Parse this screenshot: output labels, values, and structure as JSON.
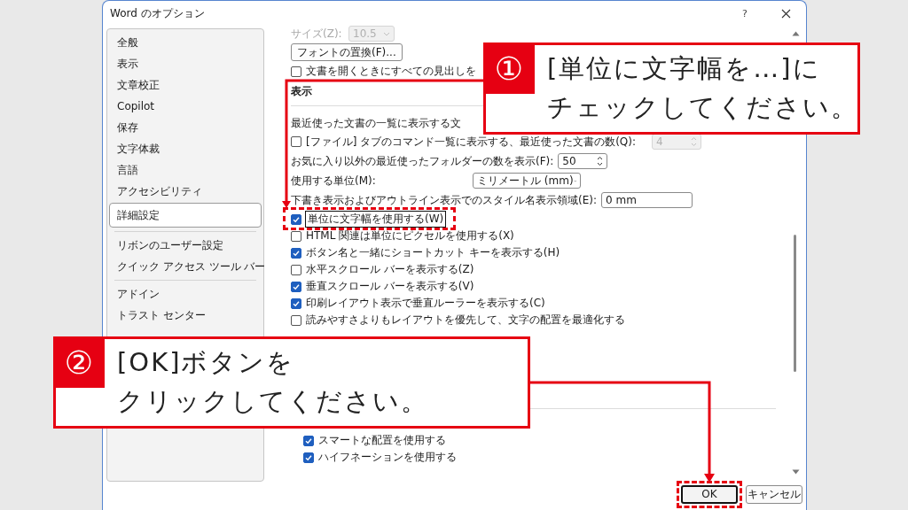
{
  "window": {
    "title": "Word のオプション",
    "help": "?"
  },
  "sidebar": {
    "items": [
      {
        "label": "全般",
        "selected": false
      },
      {
        "label": "表示",
        "selected": false
      },
      {
        "label": "文章校正",
        "selected": false
      },
      {
        "label": "Copilot",
        "selected": false
      },
      {
        "label": "保存",
        "selected": false
      },
      {
        "label": "文字体裁",
        "selected": false
      },
      {
        "label": "言語",
        "selected": false
      },
      {
        "label": "アクセシビリティ",
        "selected": false
      },
      {
        "label": "詳細設定",
        "selected": true
      },
      {
        "label": "リボンのユーザー設定",
        "selected": false
      },
      {
        "label": "クイック アクセス ツール バー",
        "selected": false
      },
      {
        "label": "アドイン",
        "selected": false
      },
      {
        "label": "トラスト センター",
        "selected": false
      }
    ]
  },
  "top": {
    "size_label": "サイズ(Z):",
    "size_value": "10.5",
    "disabled": true,
    "font_button": "フォントの置換(F)...",
    "open_checkbox": {
      "label": "文書を開くときにすべての見出しを",
      "checked": false
    }
  },
  "display": {
    "heading": "表示",
    "rows": [
      {
        "kind": "label",
        "label": "最近使った文書の一覧に表示する文"
      },
      {
        "kind": "checkbox",
        "label": "[ファイル] タブのコマンド一覧に表示する、最近使った文書の数(Q):",
        "checked": false,
        "focused": false,
        "highlighted": false,
        "control": {
          "kind": "spin",
          "value": "4",
          "disabled": true
        }
      },
      {
        "kind": "label",
        "label": "お気に入り以外の最近使ったフォルダーの数を表示(F):",
        "control": {
          "kind": "spin",
          "value": "50",
          "disabled": false
        }
      },
      {
        "kind": "label",
        "label": "使用する単位(M):",
        "control": {
          "kind": "select",
          "value": "ミリメートル (mm)",
          "disabled": false
        }
      },
      {
        "kind": "label",
        "label": "下書き表示およびアウトライン表示でのスタイル名表示領域(E):",
        "control": {
          "kind": "text",
          "value": "0 mm",
          "disabled": false
        }
      },
      {
        "kind": "checkbox",
        "label": "単位に文字幅を使用する(W)",
        "checked": true,
        "focused": true,
        "highlighted": true
      },
      {
        "kind": "checkbox",
        "label": "HTML 関連は単位にピクセルを使用する(X)",
        "checked": false,
        "focused": false,
        "highlighted": false
      },
      {
        "kind": "checkbox",
        "label": "ボタン名と一緒にショートカット キーを表示する(H)",
        "checked": true,
        "focused": false,
        "highlighted": false
      },
      {
        "kind": "checkbox",
        "label": "水平スクロール バーを表示する(Z)",
        "checked": false,
        "focused": false,
        "highlighted": false
      },
      {
        "kind": "checkbox",
        "label": "垂直スクロール バーを表示する(V)",
        "checked": true,
        "focused": false,
        "highlighted": false
      },
      {
        "kind": "checkbox",
        "label": "印刷レイアウト表示で垂直ルーラーを表示する(C)",
        "checked": true,
        "focused": false,
        "highlighted": false
      },
      {
        "kind": "checkbox",
        "label": "読みやすさよりもレイアウトを優先して、文字の配置を最適化する",
        "checked": false,
        "focused": false,
        "highlighted": false
      }
    ]
  },
  "typography": {
    "rows": [
      {
        "kind": "checkbox",
        "label": "スマートな配置を使用する",
        "checked": true,
        "focused": false,
        "highlighted": false
      },
      {
        "kind": "checkbox",
        "label": "ハイフネーションを使用する",
        "checked": true,
        "focused": false,
        "highlighted": false
      }
    ]
  },
  "buttons": [
    {
      "label": "OK",
      "default": true,
      "highlighted": true
    },
    {
      "label": "キャンセル",
      "default": false,
      "highlighted": false
    }
  ],
  "callouts": [
    {
      "number": "①",
      "lines": [
        "[単位に文字幅を…]に",
        "チェックしてください。"
      ]
    },
    {
      "number": "②",
      "lines": [
        "[OK]ボタンを",
        "クリックしてください。"
      ]
    }
  ]
}
